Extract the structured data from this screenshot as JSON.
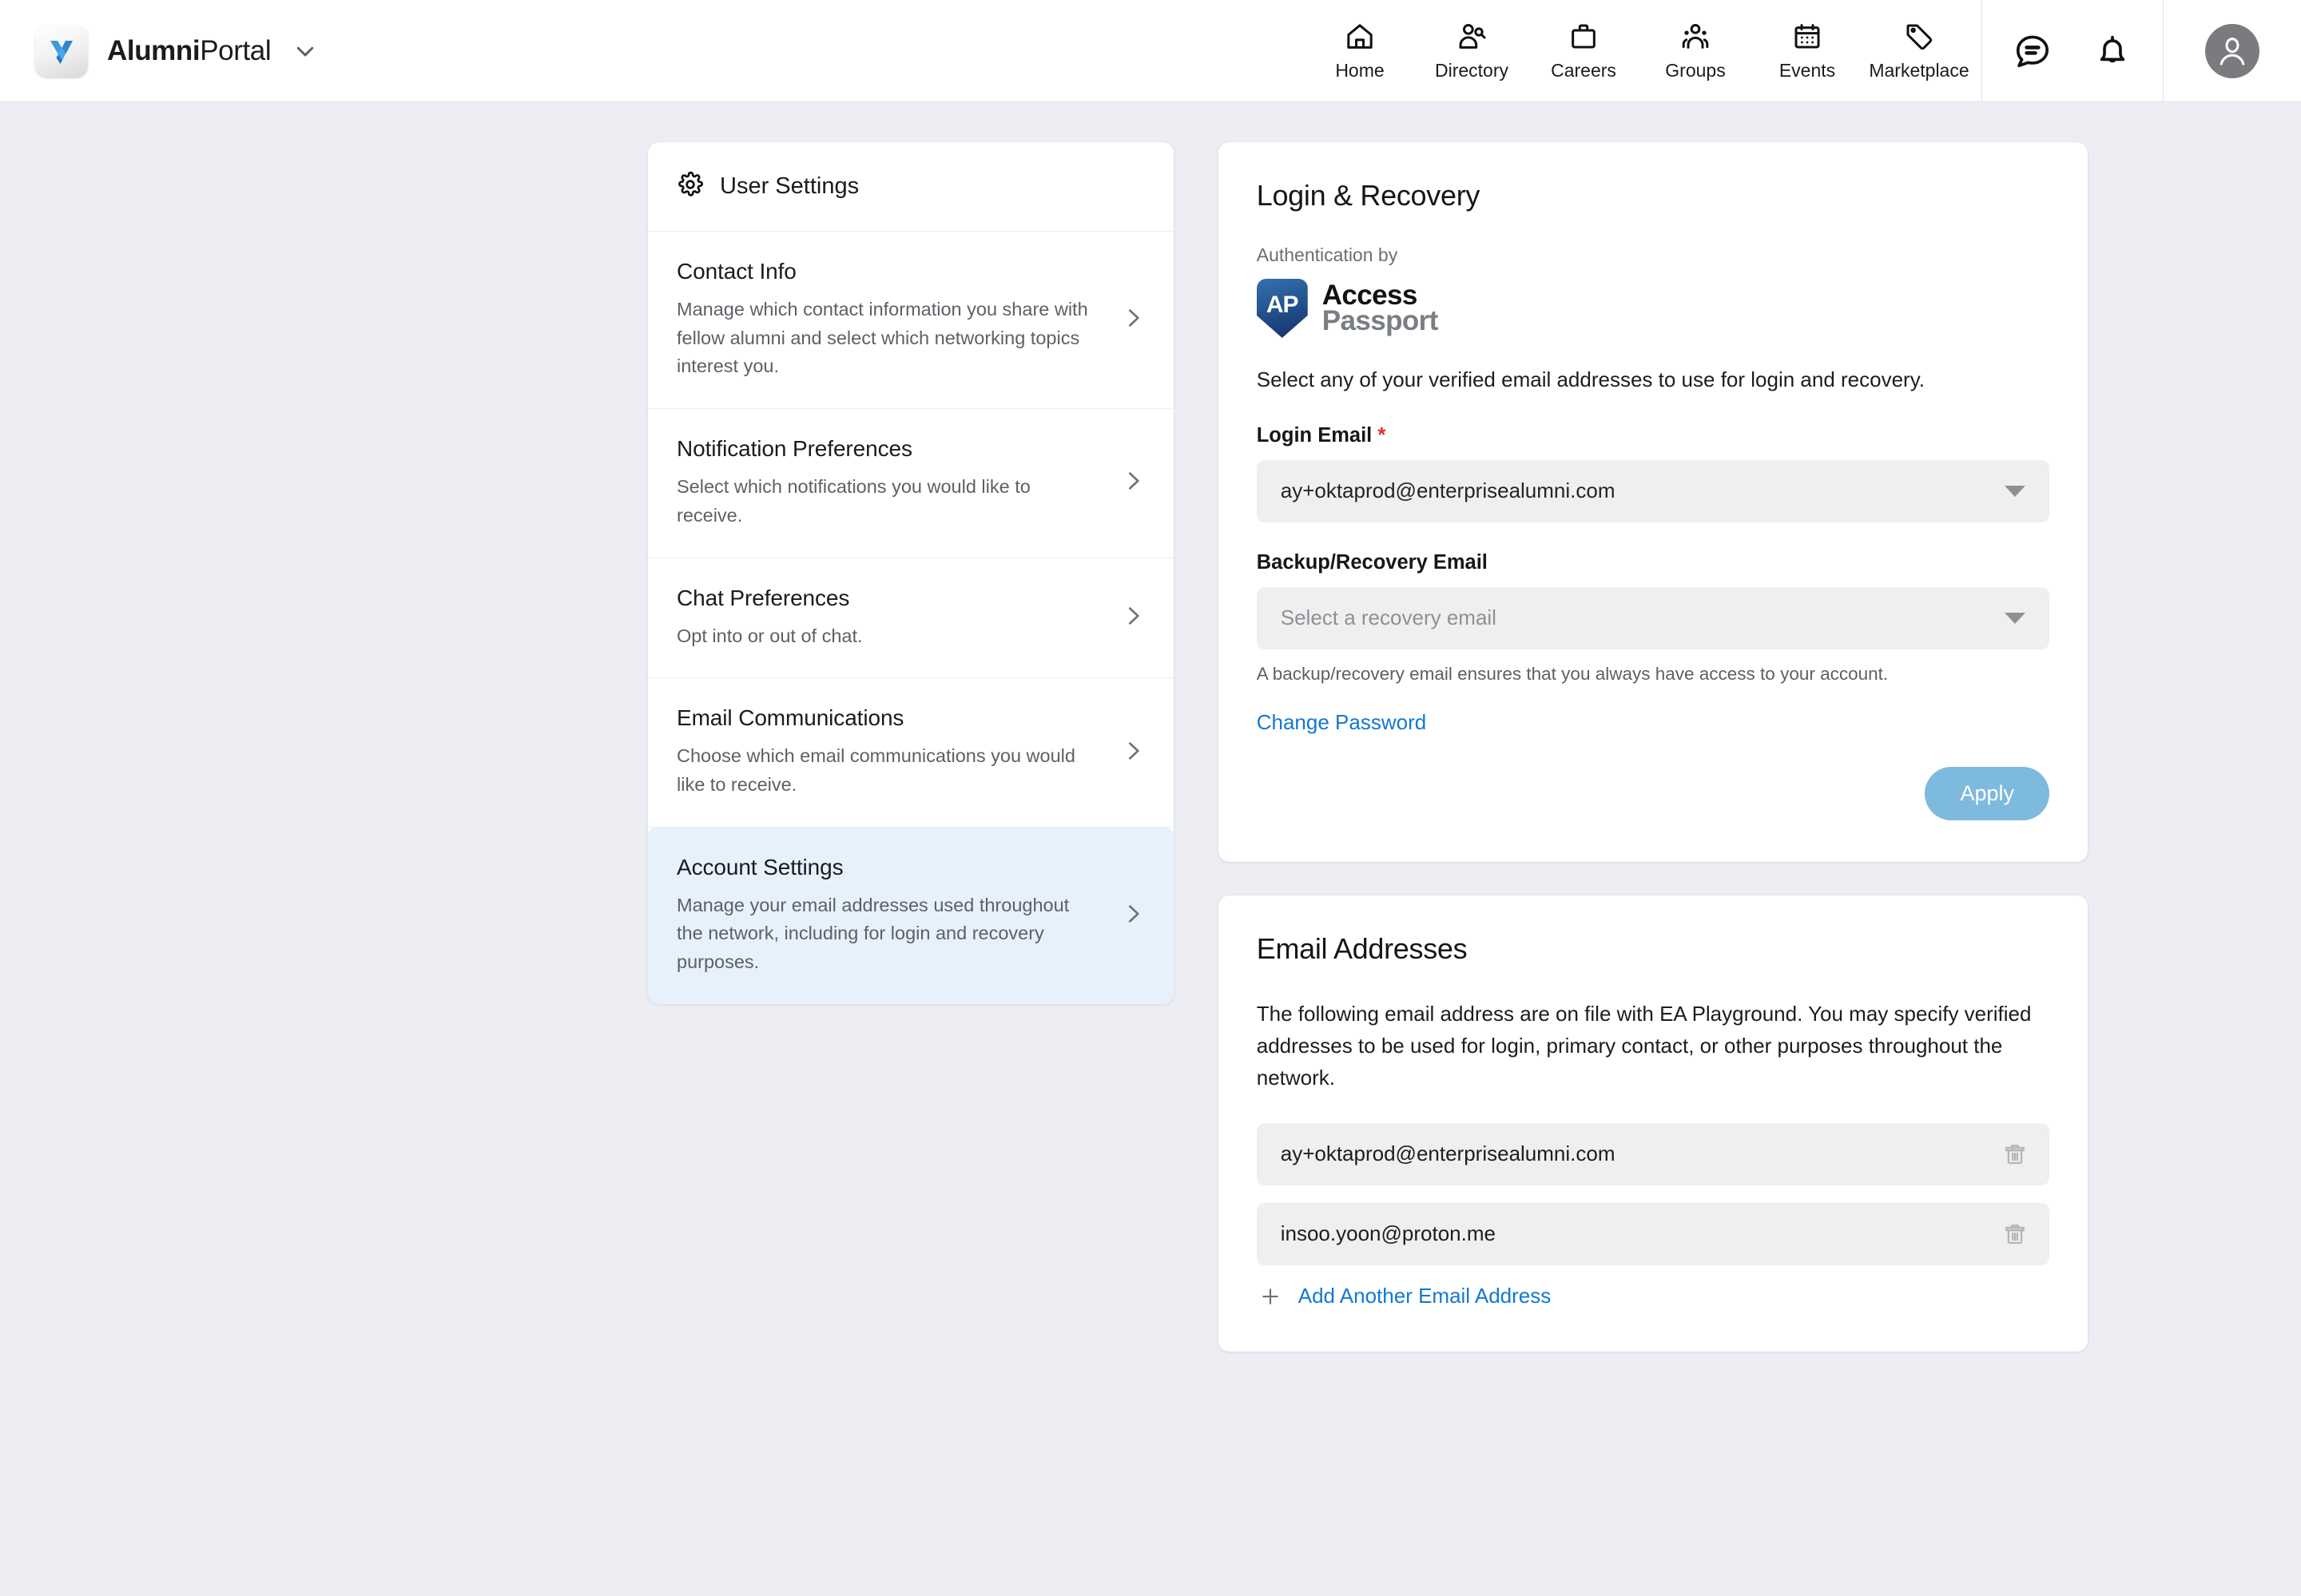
{
  "brand": {
    "name_bold": "Alumni",
    "name_light": "Portal",
    "logo_letter": "Y"
  },
  "topnav": {
    "items": [
      {
        "label": "Home",
        "icon": "home-icon"
      },
      {
        "label": "Directory",
        "icon": "person-search-icon"
      },
      {
        "label": "Careers",
        "icon": "briefcase-icon"
      },
      {
        "label": "Groups",
        "icon": "people-group-icon"
      },
      {
        "label": "Events",
        "icon": "calendar-icon"
      },
      {
        "label": "Marketplace",
        "icon": "tag-icon"
      }
    ],
    "actions": [
      {
        "icon": "chat-bubble-icon"
      },
      {
        "icon": "bell-icon"
      }
    ],
    "avatar": "user-avatar-icon"
  },
  "sidebar": {
    "header": "User Settings",
    "header_icon": "gear-icon",
    "items": [
      {
        "title": "Contact Info",
        "desc": "Manage which contact information you share with fellow alumni and select which networking topics interest you.",
        "active": false
      },
      {
        "title": "Notification Preferences",
        "desc": "Select which notifications you would like to receive.",
        "active": false
      },
      {
        "title": "Chat Preferences",
        "desc": "Opt into or out of chat.",
        "active": false
      },
      {
        "title": "Email Communications",
        "desc": "Choose which email communications you would like to receive.",
        "active": false
      },
      {
        "title": "Account Settings",
        "desc": "Manage your email addresses used throughout the network, including for login and recovery purposes.",
        "active": true
      }
    ]
  },
  "login_recovery": {
    "title": "Login & Recovery",
    "auth_by_label": "Authentication by",
    "provider": {
      "badge_text": "AP",
      "word_one": "Access",
      "word_two": "Passport"
    },
    "lead": "Select any of your verified email addresses to use for login and recovery.",
    "login_email": {
      "label": "Login Email",
      "required_mark": "*",
      "value": "ay+oktaprod@enterprisealumni.com"
    },
    "backup_email": {
      "label": "Backup/Recovery Email",
      "placeholder": "Select a recovery email",
      "helper": "A backup/recovery email ensures that you always have access to your account."
    },
    "change_password_link": "Change Password",
    "apply_button": "Apply"
  },
  "email_addresses": {
    "title": "Email Addresses",
    "description": "The following email address are on file with EA Playground. You may specify verified addresses to be used for login, primary contact, or other purposes throughout the network.",
    "rows": [
      {
        "address": "ay+oktaprod@enterprisealumni.com",
        "delete_icon": "trash-icon"
      },
      {
        "address": "insoo.yoon@proton.me",
        "delete_icon": "trash-icon"
      }
    ],
    "add_label": "Add Another Email Address",
    "add_icon": "plus-icon"
  },
  "colors": {
    "page_bg": "#edeef3",
    "accent_link": "#1378cf",
    "active_item_bg": "#e6f1fc",
    "apply_button": "#7dbade",
    "required_red": "#e03030",
    "field_bg": "#efefef"
  }
}
